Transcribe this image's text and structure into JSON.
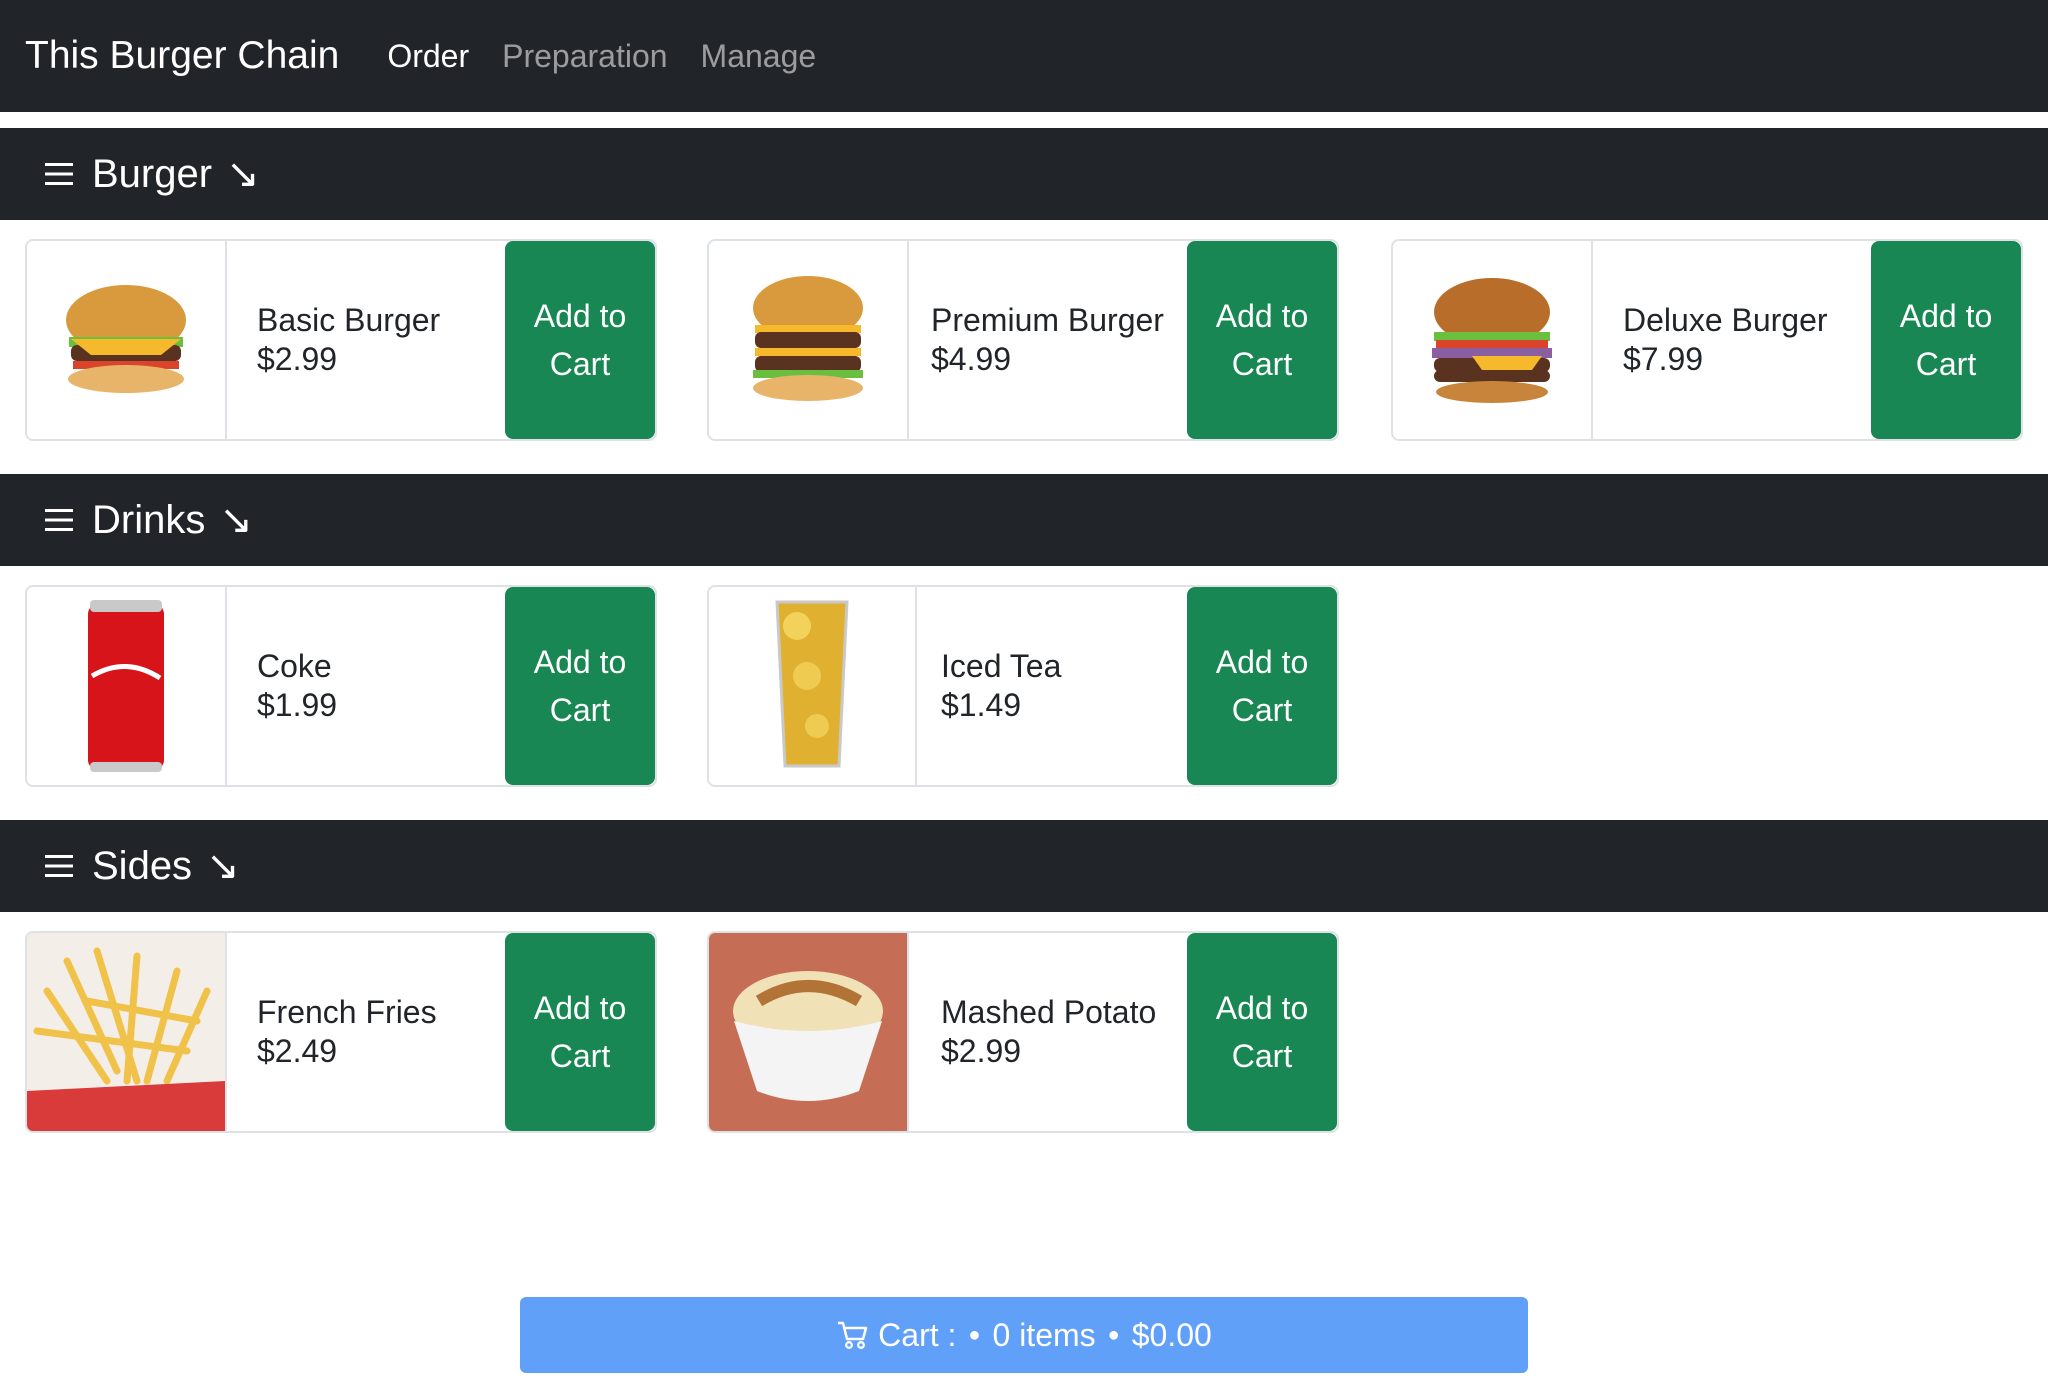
{
  "nav": {
    "brand": "This Burger Chain",
    "links": [
      "Order",
      "Preparation",
      "Manage"
    ]
  },
  "add_label": "Add to Cart",
  "sections": [
    {
      "title": "Burger",
      "items": [
        {
          "name": "Basic Burger",
          "price": "$2.99"
        },
        {
          "name": "Premium Burger",
          "price": "$4.99"
        },
        {
          "name": "Deluxe Burger",
          "price": "$7.99"
        }
      ]
    },
    {
      "title": "Drinks",
      "items": [
        {
          "name": "Coke",
          "price": "$1.99"
        },
        {
          "name": "Iced Tea",
          "price": "$1.49"
        }
      ]
    },
    {
      "title": "Sides",
      "items": [
        {
          "name": "French Fries",
          "price": "$2.49"
        },
        {
          "name": "Mashed Potato",
          "price": "$2.99"
        }
      ]
    }
  ],
  "cart": {
    "label": "Cart :",
    "count": "0 items",
    "total": "$0.00"
  },
  "colors": {
    "navbar": "#212529",
    "add_button": "#198754",
    "cart_bar": "#61a0f8"
  },
  "icons": {
    "section": "hamburger-menu-icon",
    "section_arrow": "arrow-down-right-icon",
    "cart": "cart-icon"
  }
}
